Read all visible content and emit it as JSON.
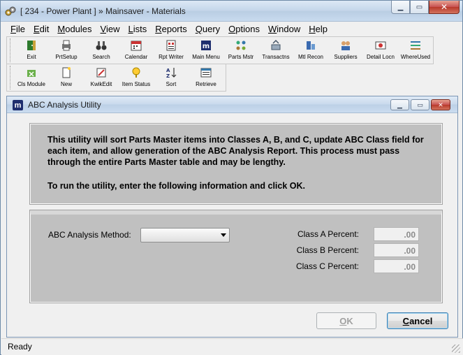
{
  "window": {
    "title": "[ 234 - Power Plant  ] » Mainsaver - Materials",
    "minimize": "▁",
    "maximize": "▭",
    "close": "✕"
  },
  "menu": [
    {
      "label": "File",
      "u": "F"
    },
    {
      "label": "Edit",
      "u": "E"
    },
    {
      "label": "Modules",
      "u": "M"
    },
    {
      "label": "View",
      "u": "V"
    },
    {
      "label": "Lists",
      "u": "L"
    },
    {
      "label": "Reports",
      "u": "R"
    },
    {
      "label": "Query",
      "u": "Q"
    },
    {
      "label": "Options",
      "u": "O"
    },
    {
      "label": "Window",
      "u": "W"
    },
    {
      "label": "Help",
      "u": "H"
    }
  ],
  "toolbar1": [
    {
      "label": "Exit",
      "icon": "exit-icon"
    },
    {
      "label": "PrtSetup",
      "icon": "printer-icon"
    },
    {
      "label": "Search",
      "icon": "binoculars-icon"
    },
    {
      "label": "Calendar",
      "icon": "calendar-icon"
    },
    {
      "label": "Rpt Writer",
      "icon": "report-writer-icon"
    },
    {
      "label": "Main Menu",
      "icon": "main-menu-icon"
    },
    {
      "label": "Parts Mstr",
      "icon": "parts-master-icon"
    },
    {
      "label": "Transactns",
      "icon": "transactions-icon"
    },
    {
      "label": "Mtl Recon",
      "icon": "material-recon-icon"
    },
    {
      "label": "Suppliers",
      "icon": "suppliers-icon"
    },
    {
      "label": "Detail Locn",
      "icon": "detail-location-icon"
    },
    {
      "label": "WhereUsed",
      "icon": "where-used-icon"
    }
  ],
  "toolbar2": [
    {
      "label": "Cls Module",
      "icon": "close-module-icon"
    },
    {
      "label": "New",
      "icon": "new-icon"
    },
    {
      "label": "KwikEdit",
      "icon": "kwikedit-icon"
    },
    {
      "label": "Item Status",
      "icon": "item-status-icon"
    },
    {
      "label": "Sort",
      "icon": "sort-icon"
    },
    {
      "label": "Retrieve",
      "icon": "retrieve-icon"
    }
  ],
  "dialog": {
    "title": "ABC Analysis Utility",
    "icon_letter": "m",
    "info_para1": "This utility will sort Parts Master items into Classes A, B, and C, update ABC Class field for each item, and allow generation of the ABC Analysis Report.  This process must pass through the entire Parts Master table and may be lengthy.",
    "info_para2": "To run the utility, enter the following information and click OK.",
    "method_label": "ABC Analysis Method:",
    "method_value": "",
    "class_a_label": "Class A Percent:",
    "class_a_value": ".00",
    "class_b_label": "Class B Percent:",
    "class_b_value": ".00",
    "class_c_label": "Class C Percent:",
    "class_c_value": ".00",
    "ok_label": "OK",
    "ok_u": "O",
    "cancel_label": "Cancel",
    "cancel_u": "C"
  },
  "status": {
    "text": "Ready"
  },
  "colors": {
    "panel": "#c0c0c0",
    "mdi_icon": "#1e2e6e"
  }
}
